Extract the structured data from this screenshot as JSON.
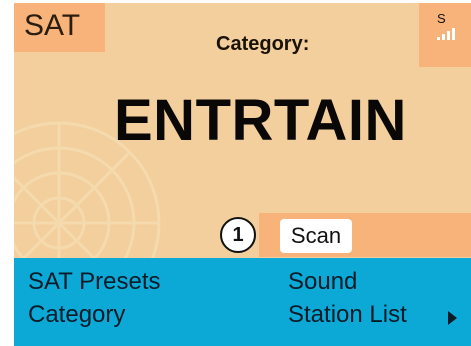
{
  "header": {
    "source_label": "SAT",
    "signal_letter": "S"
  },
  "main": {
    "caption": "Category:",
    "value": "ENTRTAIN"
  },
  "action": {
    "step_number": "1",
    "scan_label": "Scan"
  },
  "menu": {
    "sat_presets": "SAT Presets",
    "category": "Category",
    "sound": "Sound",
    "station_list": "Station List"
  },
  "colors": {
    "background": "#f2cf9c",
    "accent": "#f7b379",
    "menu_bar": "#0ca8d6"
  },
  "icons": {
    "signal": "signal-strength-icon",
    "dish": "satellite-dish-icon",
    "arrow": "chevron-right-icon"
  }
}
